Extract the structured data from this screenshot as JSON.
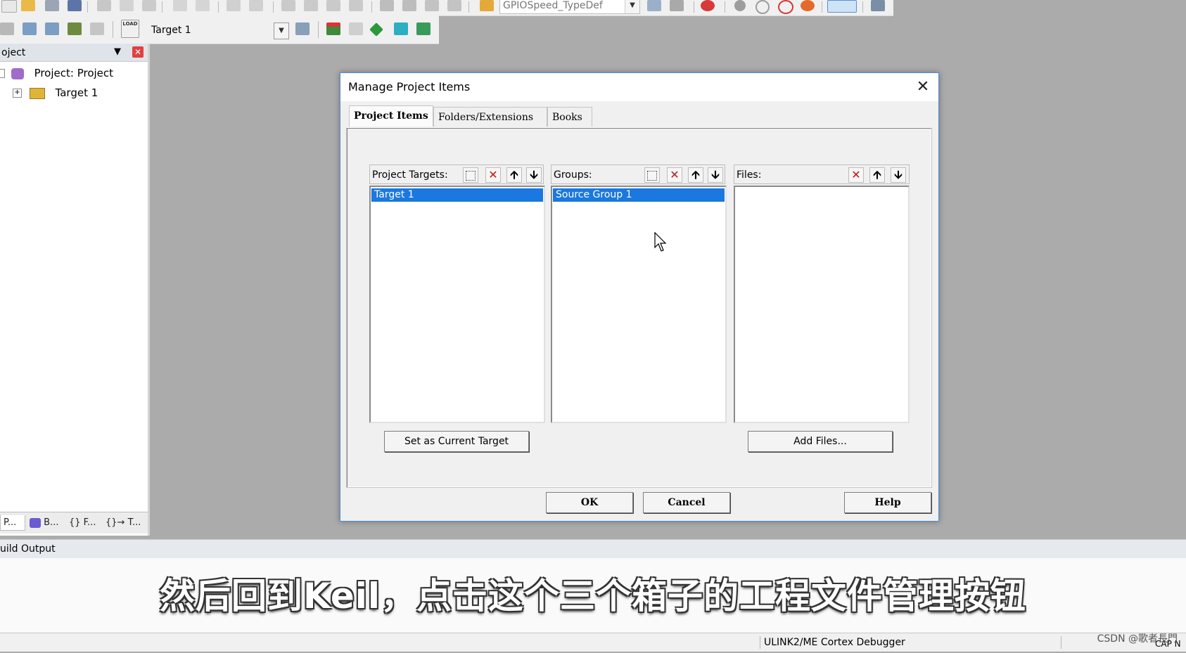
{
  "toolbar1": {
    "struct_combo": "GPIOSpeed_TypeDef"
  },
  "toolbar2": {
    "load_label": "LOAD",
    "target_combo": "Target 1"
  },
  "project_panel": {
    "title": "oject",
    "tree": [
      {
        "label": "Project: Project"
      },
      {
        "label": "Target 1"
      }
    ],
    "tabs": [
      "P...",
      "B...",
      "{} F...",
      "{}→ T..."
    ]
  },
  "dialog": {
    "title": "Manage Project Items",
    "tabs": [
      "Project Items",
      "Folders/Extensions",
      "Books"
    ],
    "columns": {
      "targets": {
        "header": "Project Targets:",
        "items": [
          "Target 1"
        ]
      },
      "groups": {
        "header": "Groups:",
        "items": [
          "Source Group 1"
        ]
      },
      "files": {
        "header": "Files:",
        "items": []
      }
    },
    "set_current_target": "Set as Current Target",
    "add_files": "Add Files...",
    "ok": "OK",
    "cancel": "Cancel",
    "help": "Help"
  },
  "build_output": {
    "title": "uild Output"
  },
  "status_bar": {
    "debugger": "ULINK2/ME Cortex Debugger",
    "cap": "CAP N"
  },
  "subtitle": "然后回到Keil，点击这个三个箱子的工程文件管理按钮",
  "watermark": "CSDN @歌者長門",
  "colors": {
    "selection": "#1a78e0",
    "delete_red": "#cc1111",
    "dialog_border": "#4c8fd6"
  }
}
